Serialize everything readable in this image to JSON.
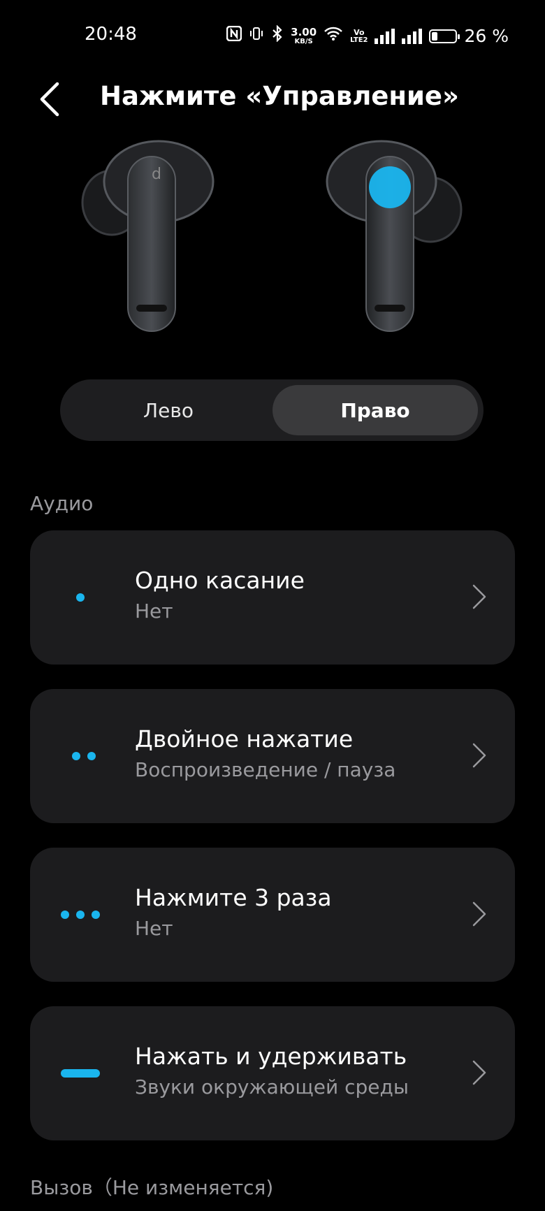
{
  "status_bar": {
    "time": "20:48",
    "net_speed_value": "3.00",
    "net_speed_unit": "KB/S",
    "volte_top": "Vo",
    "volte_bottom": "LTE2",
    "battery_text": "26 %",
    "battery_level": 0.26
  },
  "header": {
    "title": "Нажмите «Управление»"
  },
  "segment": {
    "left_label": "Лево",
    "right_label": "Право",
    "selected": "Право"
  },
  "sections": {
    "audio_label": "Аудио",
    "call_label": "Вызов（Не изменяется)"
  },
  "controls": [
    {
      "title": "Одно касание",
      "value": "Нет"
    },
    {
      "title": "Двойное нажатие",
      "value": "Воспроизведение / пауза"
    },
    {
      "title": "Нажмите 3 раза",
      "value": "Нет"
    },
    {
      "title": "Нажать и удерживать",
      "value": "Звуки окружающей среды"
    }
  ],
  "colors": {
    "accent": "#1ab5ee",
    "card_bg": "#1c1c1e",
    "page_bg": "#000000",
    "secondary_text": "#9a9a9e"
  }
}
